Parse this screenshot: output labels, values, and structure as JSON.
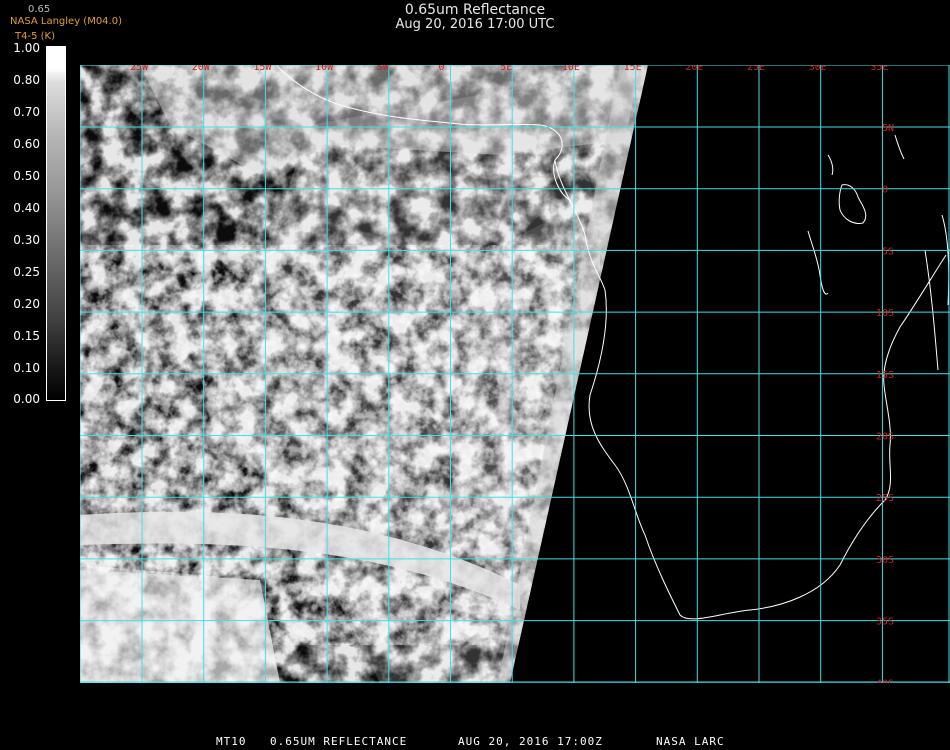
{
  "title": {
    "line1": "0.65um Reflectance",
    "line2": "Aug 20, 2016 17:00 UTC"
  },
  "credit": {
    "line1": "NASA Langley (M04.0)",
    "line2": "T4-5 (K)"
  },
  "colorbar": {
    "title": "0.65",
    "labels": [
      "1.00",
      "0.80",
      "0.70",
      "0.60",
      "0.50",
      "0.40",
      "0.30",
      "0.25",
      "0.20",
      "0.15",
      "0.10",
      "0.00"
    ]
  },
  "map": {
    "longitude_labels": [
      "25W",
      "20W",
      "15W",
      "10W",
      "5W",
      "0",
      "5E",
      "10E",
      "15E",
      "20E",
      "25E",
      "30E",
      "35E"
    ],
    "latitude_labels": [
      "5N",
      "0",
      "5S",
      "10S",
      "15S",
      "20S",
      "25S",
      "30S",
      "35S",
      "40S"
    ],
    "grid_color": "#40e0e8",
    "label_color": "#d02020",
    "coastline_color": "#ffffff"
  },
  "footer": {
    "sat": "MT10",
    "product": "0.65UM REFLECTANCE",
    "datetime": "AUG 20, 2016 17:00Z",
    "org": "NASA LARC"
  }
}
